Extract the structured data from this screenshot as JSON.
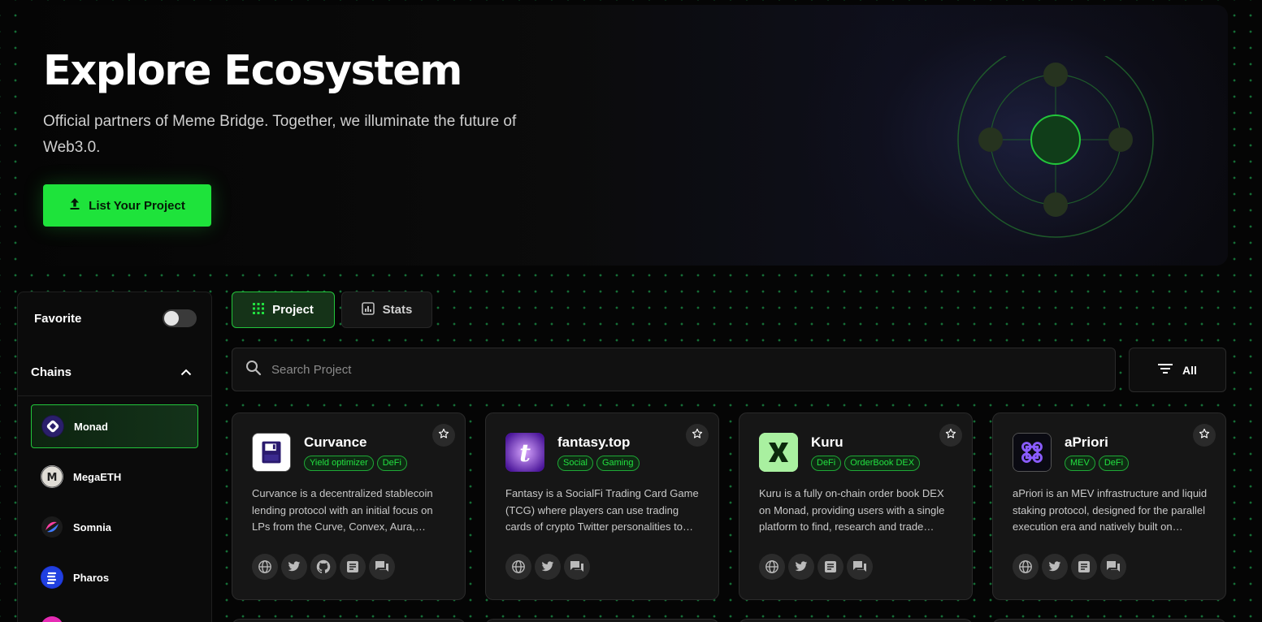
{
  "hero": {
    "title": "Explore Ecosystem",
    "subtitle": "Official partners of Meme Bridge. Together, we illuminate the future of Web3.0.",
    "cta_label": "List Your Project"
  },
  "sidebar": {
    "favorite_label": "Favorite",
    "favorite_on": false,
    "chains_label": "Chains",
    "chains": [
      {
        "label": "Monad",
        "active": true
      },
      {
        "label": "MegaETH",
        "active": false
      },
      {
        "label": "Somnia",
        "active": false
      },
      {
        "label": "Pharos",
        "active": false
      }
    ]
  },
  "tabs": {
    "project_label": "Project",
    "stats_label": "Stats",
    "active": "Project"
  },
  "search": {
    "placeholder": "Search Project",
    "value": ""
  },
  "filter": {
    "label": "All"
  },
  "cards": [
    {
      "name": "Curvance",
      "tags": [
        "Yield optimizer",
        "DeFi"
      ],
      "description": "Curvance is a decentralized stablecoin lending protocol with an initial focus on LPs from the Curve, Convex, Aura, Balancer and other ecosystems.",
      "links": [
        "globe-icon",
        "twitter-icon",
        "github-icon",
        "docs-icon",
        "chat-icon"
      ]
    },
    {
      "name": "fantasy.top",
      "tags": [
        "Social",
        "Gaming"
      ],
      "description": "Fantasy is a SocialFi Trading Card Game (TCG) where players can use trading cards of crypto Twitter personalities to compete.",
      "links": [
        "globe-icon",
        "twitter-icon",
        "chat-icon"
      ]
    },
    {
      "name": "Kuru",
      "tags": [
        "DeFi",
        "OrderBook DEX"
      ],
      "description": "Kuru is a fully on-chain order book DEX on Monad, providing users with a single platform to find, research and trade tokens.",
      "links": [
        "globe-icon",
        "twitter-icon",
        "docs-icon",
        "chat-icon"
      ]
    },
    {
      "name": "aPriori",
      "tags": [
        "MEV",
        "DeFi"
      ],
      "description": "aPriori is an MEV infrastructure and liquid staking protocol, designed for the parallel execution era and natively built on Monad.",
      "links": [
        "globe-icon",
        "twitter-icon",
        "docs-icon",
        "chat-icon"
      ]
    }
  ],
  "colors": {
    "accent": "#1ee33b",
    "background": "#050505",
    "card": "#161616"
  }
}
